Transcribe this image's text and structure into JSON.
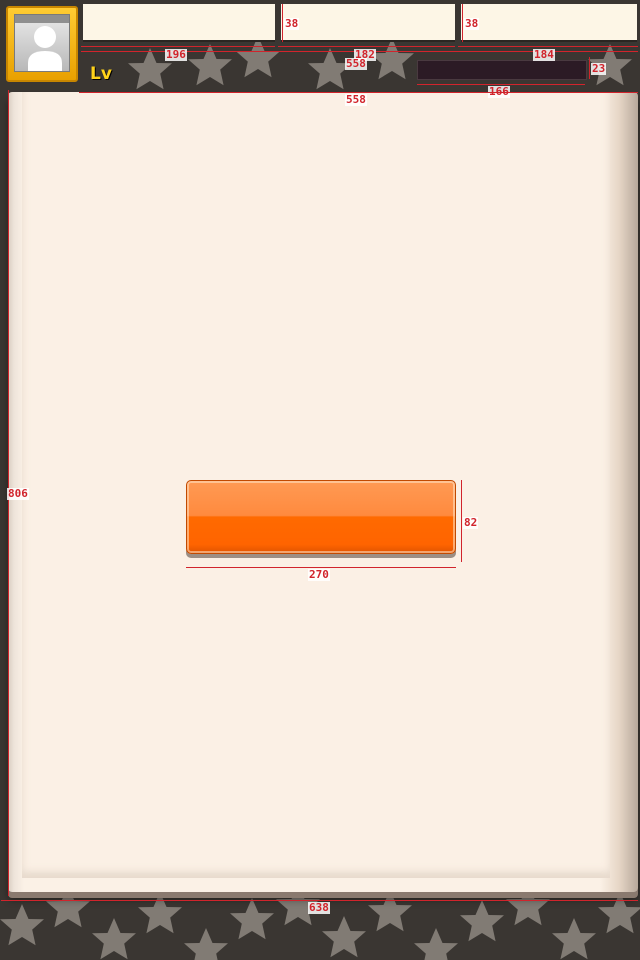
{
  "header": {
    "level_label": "Lv"
  },
  "main": {
    "primary_button_label": ""
  },
  "annotations": {
    "stat1_width": "196",
    "stat2_width": "182",
    "stat3_width": "184",
    "stat_height_a": "38",
    "stat_height_b": "38",
    "row_width_top": "558",
    "row_width_bottom": "558",
    "dark_bar_width": "166",
    "dark_bar_height": "23",
    "panel_height": "806",
    "button_width": "270",
    "button_height": "82",
    "footer_width": "638"
  },
  "colors": {
    "background": "#3b3733",
    "panel": "#fbf0e5",
    "button": "#ff6a00",
    "avatar_frame": "#e8a000",
    "level_text": "#ffd21a",
    "annotation": "#d1242c"
  }
}
